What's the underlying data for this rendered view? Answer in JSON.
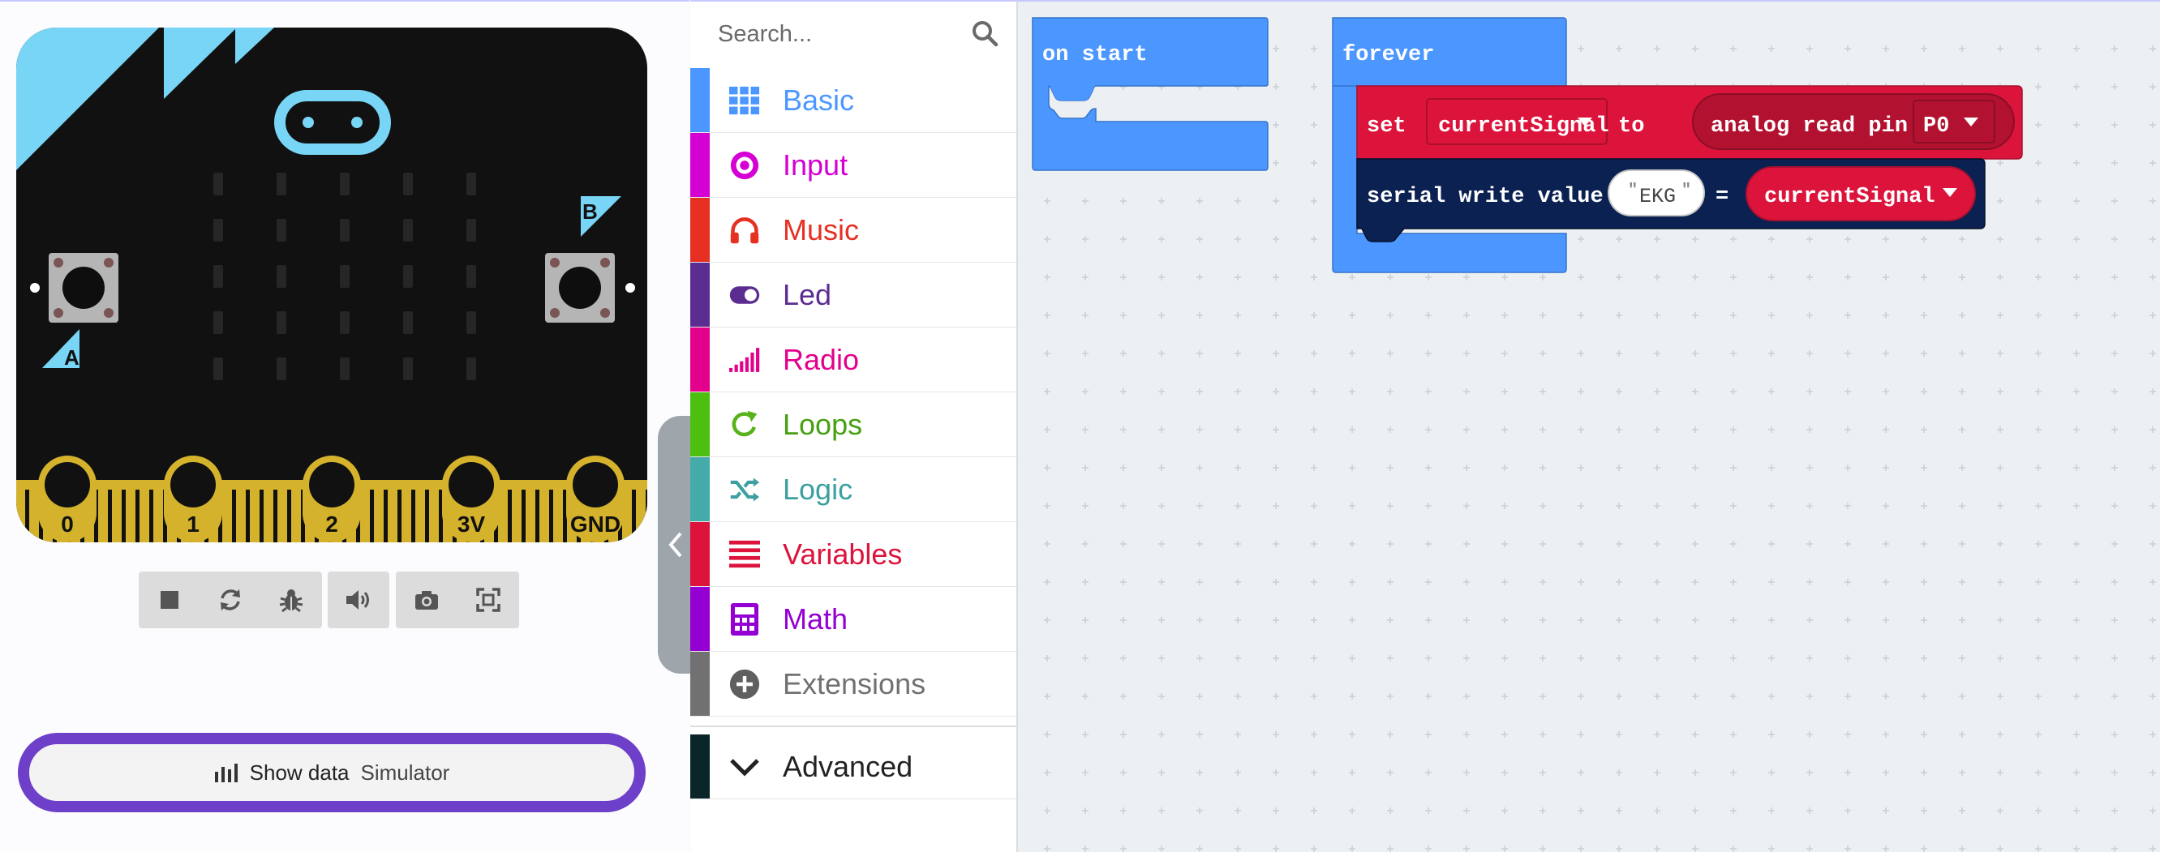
{
  "simulator": {
    "board": {
      "button_a_label": "A",
      "button_b_label": "B",
      "pins": [
        "0",
        "1",
        "2",
        "3V",
        "GND"
      ]
    },
    "toolbar": {
      "icons": [
        "stop-icon",
        "restart-icon",
        "debug-icon",
        "mute-icon",
        "screenshot-icon",
        "fullscreen-icon"
      ]
    },
    "show_data": {
      "label": "Show data",
      "sublabel": "Simulator"
    }
  },
  "toolbox": {
    "search_placeholder": "Search...",
    "categories": [
      {
        "label": "Basic",
        "color": "#4c97ff",
        "icon": "grid-icon"
      },
      {
        "label": "Input",
        "color": "#d400d4",
        "icon": "target-icon"
      },
      {
        "label": "Music",
        "color": "#e63022",
        "icon": "headphones-icon"
      },
      {
        "label": "Led",
        "color": "#5c2d91",
        "icon": "toggle-icon"
      },
      {
        "label": "Radio",
        "color": "#e3008c",
        "icon": "signal-icon"
      },
      {
        "label": "Loops",
        "color": "#00aa00",
        "icon": "refresh-icon"
      },
      {
        "label": "Logic",
        "color": "#00a4a6",
        "icon": "shuffle-icon"
      },
      {
        "label": "Variables",
        "color": "#dc143c",
        "icon": "list-icon"
      },
      {
        "label": "Math",
        "color": "#9400d3",
        "icon": "calculator-icon"
      },
      {
        "label": "Extensions",
        "color": "#717171",
        "icon": "plus-circle-icon"
      }
    ],
    "advanced": {
      "label": "Advanced",
      "color": "#0b2628",
      "icon": "chevron-down-icon"
    }
  },
  "workspace": {
    "on_start": {
      "label": "on start"
    },
    "forever": {
      "label": "forever"
    },
    "set_block": {
      "keyword": "set",
      "variable": "currentSignal",
      "to": "to",
      "reporter": "analog read pin",
      "pin": "P0"
    },
    "serial_block": {
      "keyword": "serial write value",
      "name": "EKG",
      "equals": "=",
      "value": "currentSignal"
    }
  }
}
